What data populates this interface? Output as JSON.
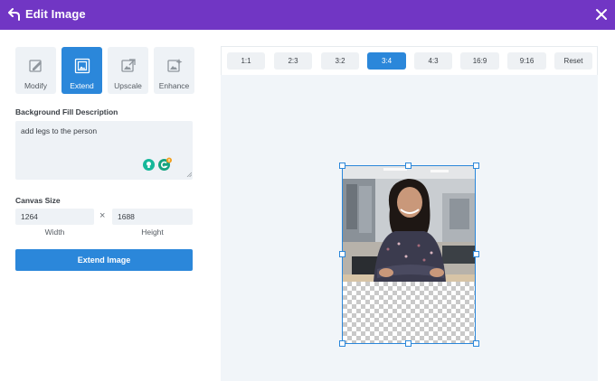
{
  "header": {
    "title": "Edit Image",
    "back_icon": "back-arrow-icon",
    "close_icon": "close-icon"
  },
  "modes": [
    {
      "label": "Modify",
      "icon": "modify-icon",
      "active": false
    },
    {
      "label": "Extend",
      "icon": "extend-icon",
      "active": true
    },
    {
      "label": "Upscale",
      "icon": "upscale-icon",
      "active": false
    },
    {
      "label": "Enhance",
      "icon": "enhance-icon",
      "active": false
    }
  ],
  "fill": {
    "label": "Background Fill Description",
    "value": "add legs to the person"
  },
  "canvas_size": {
    "label": "Canvas Size",
    "width": "1264",
    "height": "1688",
    "width_label": "Width",
    "height_label": "Height",
    "separator": "×"
  },
  "extend_button": "Extend Image",
  "ratios": [
    "1:1",
    "2:3",
    "3:2",
    "3:4",
    "4:3",
    "16:9",
    "9:16",
    "Reset"
  ],
  "selected_ratio": "3:4",
  "colors": {
    "header": "#7136c4",
    "accent": "#2b87da"
  }
}
